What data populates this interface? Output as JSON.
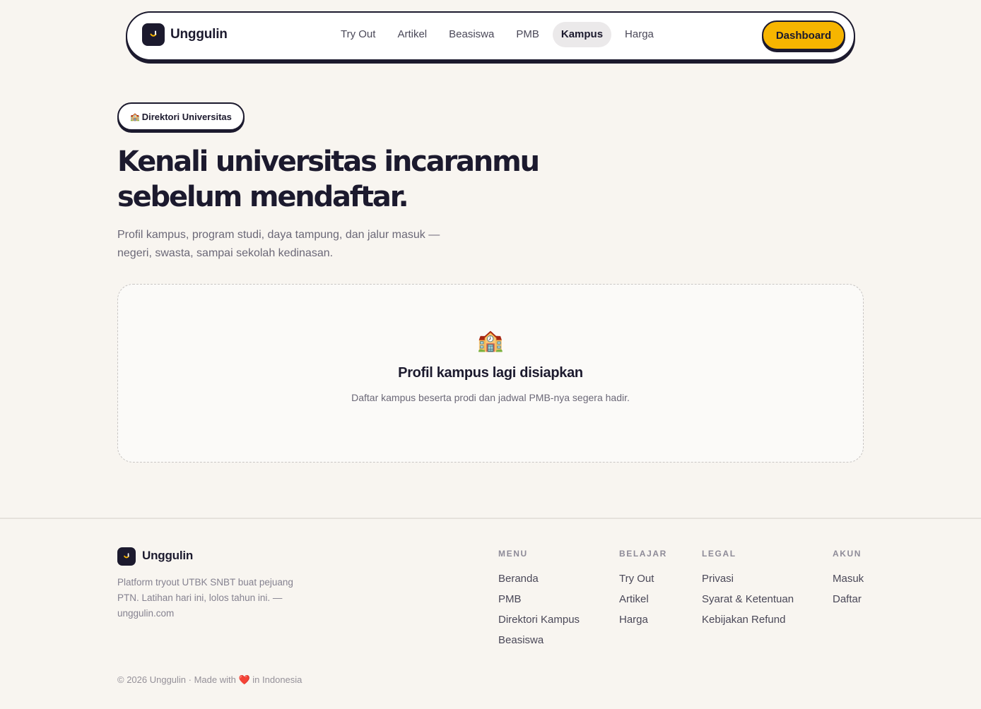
{
  "brand": {
    "name": "Unggulin",
    "logo_icon": "smile-icon"
  },
  "nav": {
    "links": [
      {
        "label": "Try Out",
        "active": false
      },
      {
        "label": "Artikel",
        "active": false
      },
      {
        "label": "Beasiswa",
        "active": false
      },
      {
        "label": "PMB",
        "active": false
      },
      {
        "label": "Kampus",
        "active": true
      },
      {
        "label": "Harga",
        "active": false
      }
    ],
    "dashboard_label": "Dashboard"
  },
  "hero": {
    "badge_icon": "🏫",
    "badge_label": "Direktori Universitas",
    "title_line1": "Kenali universitas incaranmu",
    "title_line2": "sebelum mendaftar.",
    "subtitle_line1": "Profil kampus, program studi, daya tampung, dan jalur masuk —",
    "subtitle_line2": "negeri, swasta, sampai sekolah kedinasan."
  },
  "empty_state": {
    "icon": "🏫",
    "title": "Profil kampus lagi disiapkan",
    "description": "Daftar kampus beserta prodi dan jadwal PMB-nya segera hadir."
  },
  "footer": {
    "brand": "Unggulin",
    "about": "Platform tryout UTBK SNBT buat pejuang PTN. Latihan hari ini, lolos tahun ini. — unggulin.com",
    "columns": [
      {
        "heading": "MENU",
        "links": [
          "Beranda",
          "PMB",
          "Direktori Kampus",
          "Beasiswa"
        ]
      },
      {
        "heading": "BELAJAR",
        "links": [
          "Try Out",
          "Artikel",
          "Harga"
        ]
      },
      {
        "heading": "LEGAL",
        "links": [
          "Privasi",
          "Syarat & Ketentuan",
          "Kebijakan Refund"
        ]
      },
      {
        "heading": "AKUN",
        "links": [
          "Masuk",
          "Daftar"
        ]
      }
    ],
    "copyright_prefix": "© 2026 Unggulin · Made with",
    "heart": "❤️",
    "copyright_suffix": "in Indonesia"
  },
  "colors": {
    "background": "#f8f5f0",
    "ink": "#1c1a2e",
    "accent": "#f7b500",
    "active_pill": "#ebe9ea",
    "heart": "#e0262f"
  }
}
